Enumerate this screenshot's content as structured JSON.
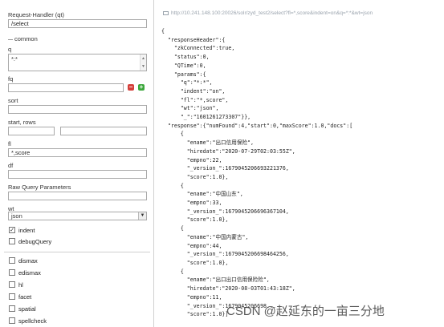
{
  "sidebar": {
    "request_handler_label": "Request-Handler (qt)",
    "request_handler_value": "/select",
    "common_label": "common",
    "q_label": "q",
    "q_value": "*:*",
    "fq_label": "fq",
    "fq_value": "",
    "sort_label": "sort",
    "sort_value": "",
    "start_rows_label": "start, rows",
    "start_value": "",
    "rows_value": "",
    "fl_label": "fl",
    "fl_value": "*,score",
    "df_label": "df",
    "df_value": "",
    "raw_label": "Raw Query Parameters",
    "raw_value": "",
    "wt_label": "wt",
    "wt_value": "json",
    "indent_label": "indent",
    "indent_checked": true,
    "debug_label": "debugQuery",
    "options": [
      "dismax",
      "edismax",
      "hl",
      "facet",
      "spatial",
      "spellcheck"
    ]
  },
  "result": {
    "url": "http://10.241.148.100:20026/solr/zyd_test2/select?fl=*,score&indent=on&q=*:*&wt=json",
    "lines": [
      "{",
      "  \"responseHeader\":{",
      "    \"zkConnected\":true,",
      "    \"status\":0,",
      "    \"QTime\":0,",
      "    \"params\":{",
      "      \"q\":\"*:*\",",
      "      \"indent\":\"on\",",
      "      \"fl\":\"*,score\",",
      "      \"wt\":\"json\",",
      "      \"_\":\"1601261273307\"}},",
      "  \"response\":{\"numFound\":4,\"start\":0,\"maxScore\":1.0,\"docs\":[",
      "      {",
      "        \"ename\":\"出口信用保险\",",
      "        \"hiredate\":\"2020-07-29T02:03:55Z\",",
      "        \"empno\":22,",
      "        \"_version_\":1679045206693221376,",
      "        \"score\":1.0},",
      "      {",
      "        \"ename\":\"中国山东\",",
      "        \"empno\":33,",
      "        \"_version_\":1679045206696367104,",
      "        \"score\":1.0},",
      "      {",
      "        \"ename\":\"中国内蒙古\",",
      "        \"empno\":44,",
      "        \"_version_\":1679045206698464256,",
      "        \"score\":1.0},",
      "      {",
      "        \"ename\":\"出口出口信用保险险\",",
      "        \"hiredate\":\"2020-08-03T01:43:18Z\",",
      "        \"empno\":11,",
      "        \"_version_\":1679045206698...",
      "        \"score\":1.0}]"
    ]
  },
  "watermark": "CSDN @赵延东的一亩三分地"
}
